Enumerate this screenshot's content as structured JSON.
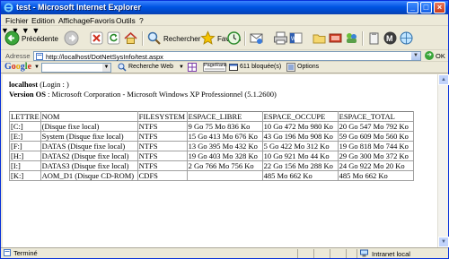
{
  "window": {
    "title": "test - Microsoft Internet Explorer"
  },
  "menu": [
    "Fichier",
    "Edition",
    "Affichage",
    "Favoris",
    "Outils",
    "?"
  ],
  "toolbar": {
    "back_label": "Précédente",
    "search_label": "Rechercher",
    "favorites_label": "Favoris"
  },
  "address": {
    "label": "Adresse",
    "url": "http://localhost/DotNetSysInfo/test.aspx",
    "go_label": "OK"
  },
  "google": {
    "logo": [
      "G",
      "o",
      "o",
      "g",
      "l",
      "e"
    ],
    "search_web_label": "Recherche Web",
    "pagerank_label": "PageRank",
    "blocked_label": "611 bloquée(s)",
    "options_label": "Options"
  },
  "page": {
    "host_label": "localhost",
    "host_suffix": " (Login : )",
    "os_label": "Version OS",
    "os_value": " : Microsoft Corporation - Microsoft Windows XP Professionnel (5.1.2600)",
    "table": {
      "headers": [
        "LETTRE",
        "NOM",
        "FILESYSTEM",
        "ESPACE_LIBRE",
        "ESPACE_OCCUPE",
        "ESPACE_TOTAL"
      ],
      "rows": [
        [
          "[C:]",
          "(Disque fixe local)",
          "NTFS",
          "9 Go 75 Mo 836 Ko",
          "10 Go 472 Mo 980 Ko",
          "20 Go 547 Mo 792 Ko"
        ],
        [
          "[E:]",
          "System (Disque fixe local)",
          "NTFS",
          "15 Go 413 Mo 676 Ko",
          "43 Go 196 Mo 908 Ko",
          "59 Go 609 Mo 560 Ko"
        ],
        [
          "[F:]",
          "DATAS (Disque fixe local)",
          "NTFS",
          "13 Go 395 Mo 432 Ko",
          "5 Go 422 Mo 312 Ko",
          "19 Go 818 Mo 744 Ko"
        ],
        [
          "[H:]",
          "DATAS2 (Disque fixe local)",
          "NTFS",
          "19 Go 403 Mo 328 Ko",
          "10 Go 921 Mo 44 Ko",
          "29 Go 300 Mo 372 Ko"
        ],
        [
          "[I:]",
          "DATAS3 (Disque fixe local)",
          "NTFS",
          "2 Go 766 Mo 756 Ko",
          "22 Go 156 Mo 288 Ko",
          "24 Go 922 Mo 20 Ko"
        ],
        [
          "[K:]",
          "AOM_D1 (Disque CD-ROM)",
          "CDFS",
          "",
          "485 Mo 662 Ko",
          "485 Mo 662 Ko"
        ]
      ]
    }
  },
  "status": {
    "left": "Terminé",
    "zone": "Intranet local"
  },
  "colors": {
    "titlebar": "#0054e3",
    "chrome": "#ece9d8",
    "border": "#a0a0a0"
  }
}
